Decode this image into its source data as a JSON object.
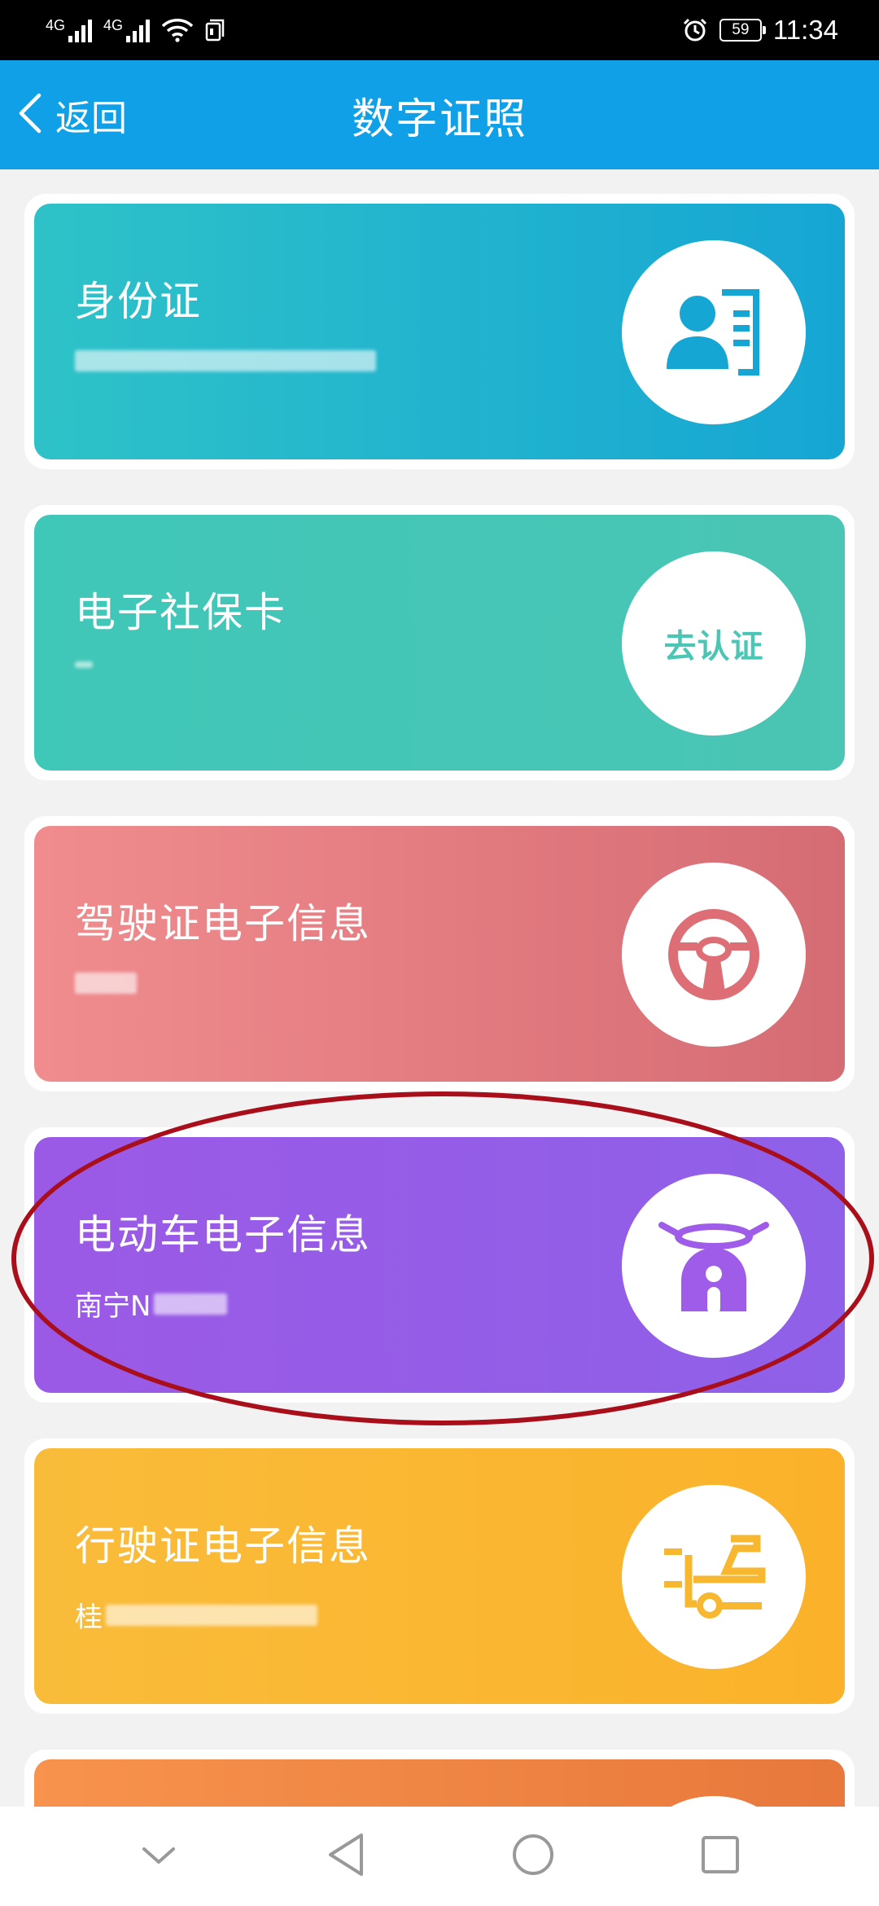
{
  "status_bar": {
    "network1": "4G",
    "network2": "4G",
    "battery": "59",
    "time": "11:34"
  },
  "header": {
    "back_label": "返回",
    "title": "数字证照"
  },
  "cards": [
    {
      "title": "身份证",
      "subtitle": "",
      "icon": "id-card-icon",
      "color": "#1aa9d2"
    },
    {
      "title": "电子社保卡",
      "subtitle": "",
      "action": "去认证",
      "color": "#4bc5b4"
    },
    {
      "title": "驾驶证电子信息",
      "subtitle": "",
      "icon": "steering-wheel-icon",
      "color": "#dd6e76"
    },
    {
      "title": "电动车电子信息",
      "subtitle": "南宁N",
      "icon": "scooter-icon",
      "color": "#9f5ce8"
    },
    {
      "title": "行驶证电子信息",
      "subtitle": "桂",
      "icon": "vehicle-icon",
      "color": "#f7b72e"
    }
  ],
  "colors": {
    "header": "#0fa0e8",
    "highlight": "#a90f1a"
  }
}
